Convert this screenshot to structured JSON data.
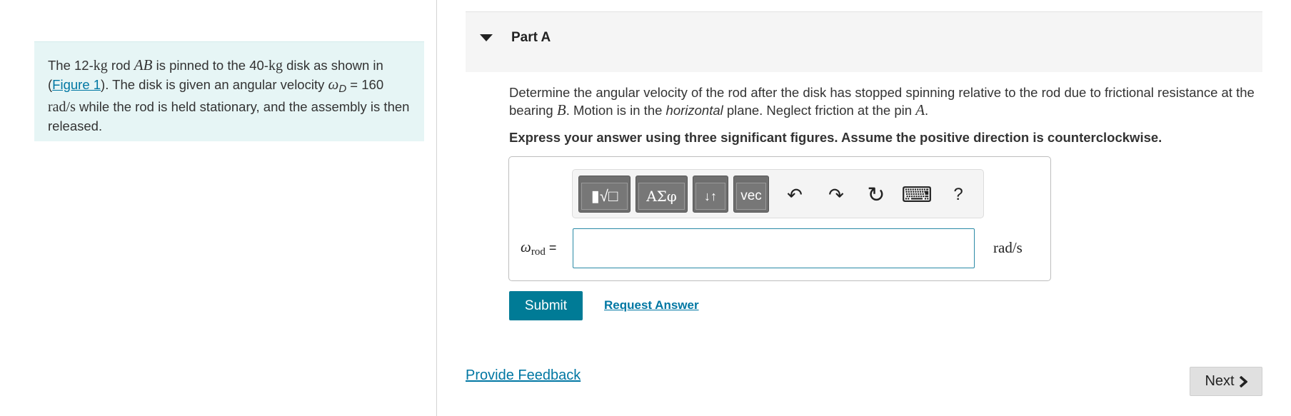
{
  "problem": {
    "t1": "The 12-",
    "kg": "kg",
    "t2": " rod ",
    "ab": "AB",
    "t3": " is pinned to the 40-",
    "kg2": "kg",
    "t4": " disk as shown in (",
    "figure_link": "Figure 1",
    "t5": "). The disk is given an angular velocity ",
    "omega": "ω",
    "omega_sub": "D",
    "t6": " = 160 ",
    "units": "rad/s",
    "t7": " while the rod is held stationary, and the assembly is then released."
  },
  "part": {
    "title": "Part A"
  },
  "question": {
    "q1": "Determine the angular velocity of the rod after the disk has stopped spinning relative to the rod due to frictional resistance at the bearing ",
    "b": "B",
    "q2": ". Motion is in the ",
    "horizontal": "horizontal",
    "q3": " plane. Neglect friction at the pin ",
    "a": "A",
    "q4": "."
  },
  "instruction": "Express your answer using three significant figures. Assume the positive direction is counterclockwise.",
  "toolbar": {
    "templates": "▮√□",
    "greek": "ΑΣφ",
    "arrows": "↓↑",
    "vec": "vec",
    "undo": "↶",
    "redo": "↷",
    "reset": "↻",
    "keyboard": "⌨",
    "help": "?"
  },
  "answer": {
    "omega": "ω",
    "sub": "rod",
    "equals": " =",
    "value": "",
    "units": "rad/s"
  },
  "buttons": {
    "submit": "Submit",
    "request": "Request Answer",
    "feedback": "Provide Feedback",
    "next": "Next"
  },
  "colors": {
    "accent": "#007b96",
    "link": "#0077a3",
    "problem_bg": "#e6f5f5"
  }
}
